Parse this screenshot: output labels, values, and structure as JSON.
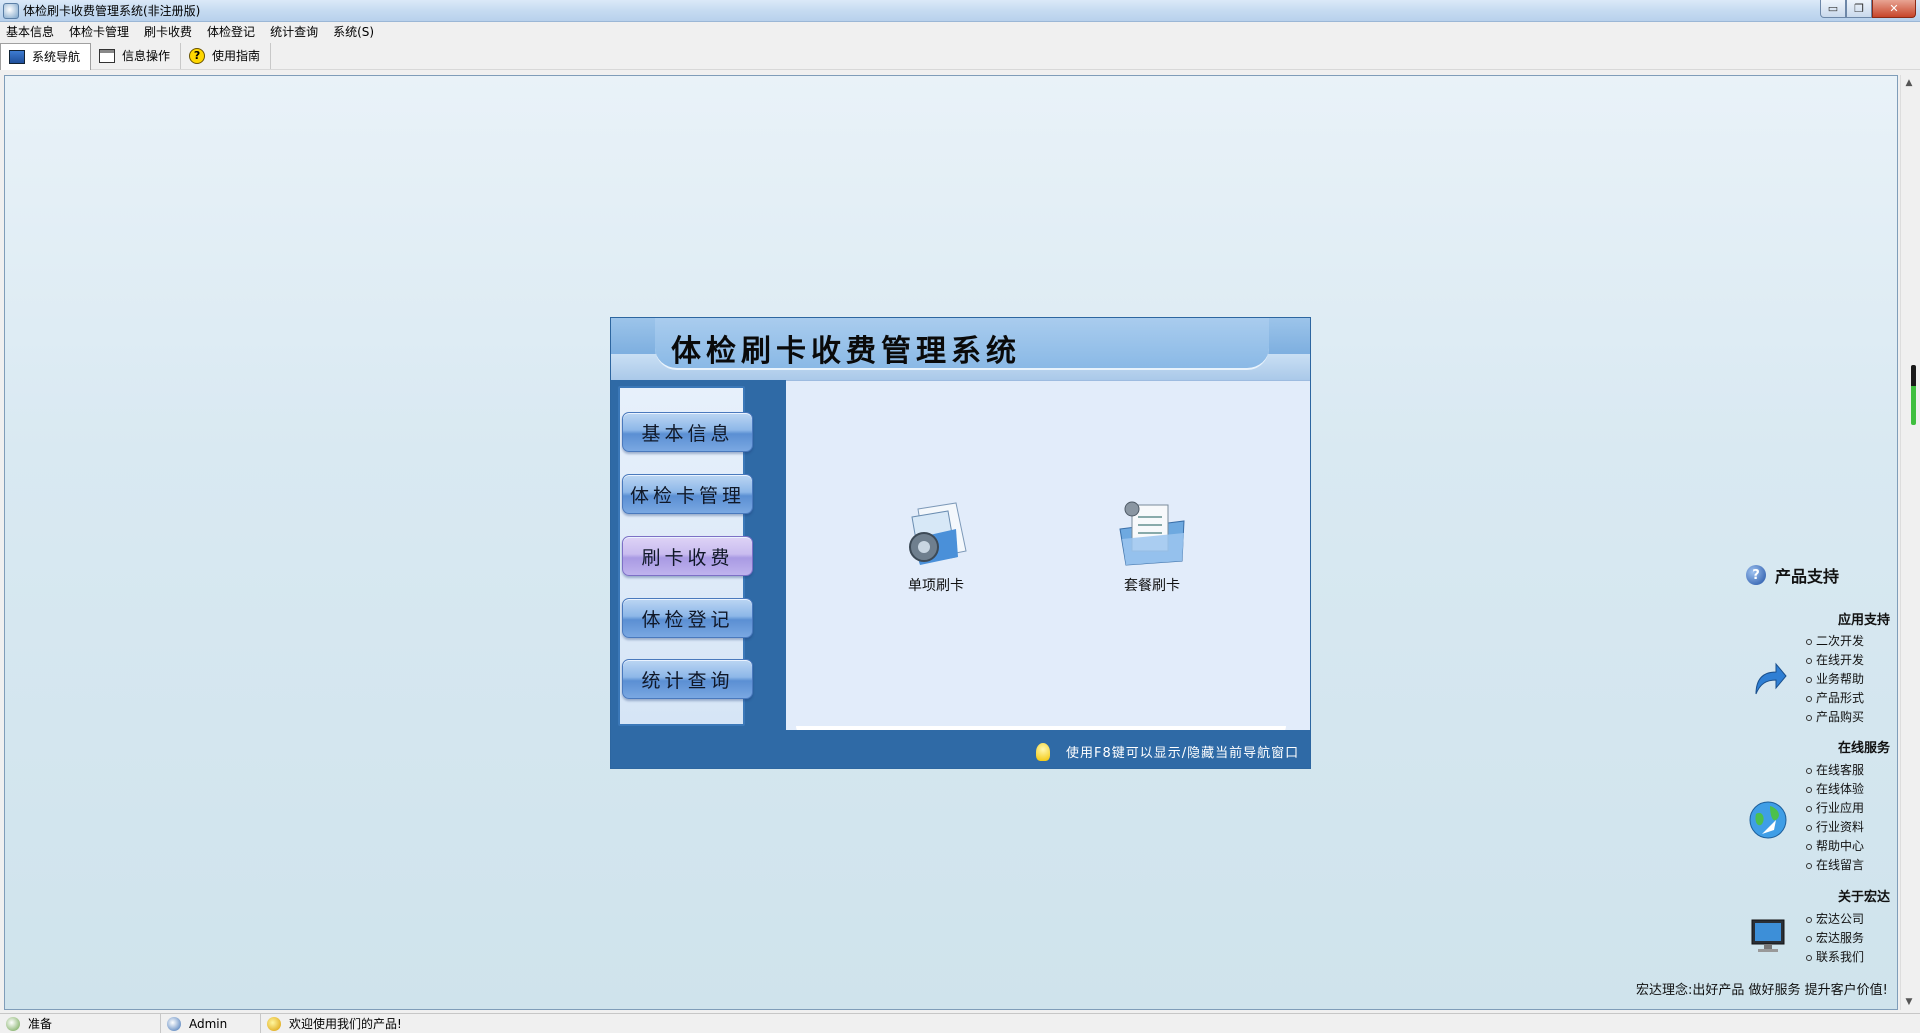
{
  "window": {
    "title": "体检刷卡收费管理系统(非注册版)",
    "controls": {
      "minimize": "▭",
      "maximize": "❐",
      "close": "✕"
    }
  },
  "menu": [
    "基本信息",
    "体检卡管理",
    "刷卡收费",
    "体检登记",
    "统计查询",
    "系统(S)"
  ],
  "toolbar": {
    "items": [
      {
        "label": "系统导航",
        "icon": "nav-monitor-icon"
      },
      {
        "label": "信息操作",
        "icon": "document-icon"
      },
      {
        "label": "使用指南",
        "icon": "help-icon"
      }
    ]
  },
  "nav_panel": {
    "title": "体检刷卡收费管理系统",
    "buttons": [
      "基本信息",
      "体检卡管理",
      "刷卡收费",
      "体检登记",
      "统计查询"
    ],
    "selected_button": "刷卡收费",
    "functions": [
      {
        "label": "单项刷卡",
        "icon": "gear-document-icon"
      },
      {
        "label": "套餐刷卡",
        "icon": "clipboard-folder-icon"
      }
    ],
    "footer_hint": "使用F8键可以显示/隐藏当前导航窗口"
  },
  "support": {
    "title": "产品支持",
    "groups": [
      {
        "title": "应用支持",
        "icon": "arrow-icon",
        "links": [
          "二次开发",
          "在线开发",
          "业务帮助",
          "产品形式",
          "产品购买"
        ]
      },
      {
        "title": "在线服务",
        "icon": "globe-icon",
        "links": [
          "在线客服",
          "在线体验",
          "行业应用",
          "行业资料",
          "帮助中心",
          "在线留言"
        ]
      },
      {
        "title": "关于宏达",
        "icon": "monitor-icon",
        "links": [
          "宏达公司",
          "宏达服务",
          "联系我们"
        ]
      }
    ],
    "slogan": "宏达理念:出好产品  做好服务  提升客户价值!"
  },
  "status": {
    "ready": "准备",
    "user": "Admin",
    "welcome": "欢迎使用我们的产品!"
  },
  "colors": {
    "panel_blue": "#2f6aa6",
    "header_blue": "#8ab9e6",
    "workspace_bg": "#d9e9f2"
  }
}
